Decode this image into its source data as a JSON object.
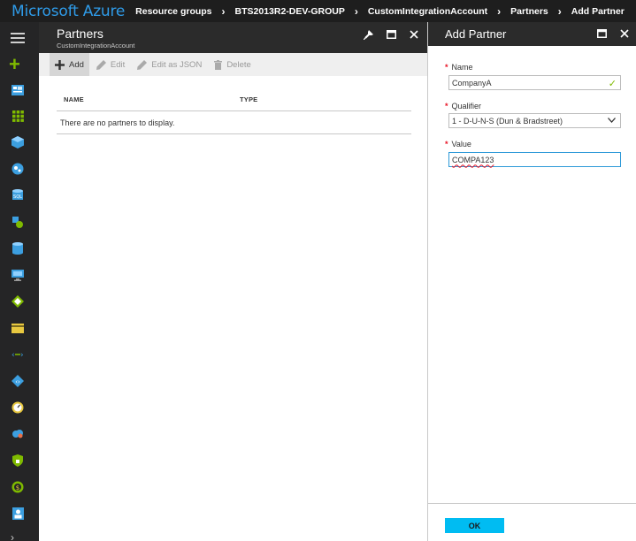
{
  "topbar": {
    "brand": "Microsoft Azure",
    "breadcrumbs": [
      "Resource groups",
      "BTS2013R2-DEV-GROUP",
      "CustomIntegrationAccount",
      "Partners",
      "Add Partner"
    ]
  },
  "rail": {
    "icons": [
      "menu-icon",
      "new-icon",
      "dashboard-icon",
      "all-resources-icon",
      "resource-groups-icon",
      "app-services-icon",
      "sql-databases-icon",
      "cloud-services-icon",
      "storage-icon",
      "virtual-machines-icon",
      "load-balancers-icon",
      "subscriptions-icon",
      "virtual-networks-icon",
      "marketplace-icon",
      "monitor-icon",
      "hdinsight-icon",
      "security-center-icon",
      "cost-icon",
      "users-icon",
      "more-services-icon"
    ]
  },
  "partners_blade": {
    "title": "Partners",
    "subtitle": "CustomIntegrationAccount",
    "commands": {
      "add": "Add",
      "edit": "Edit",
      "edit_json": "Edit as JSON",
      "delete": "Delete"
    },
    "columns": {
      "name": "NAME",
      "type": "TYPE"
    },
    "empty_message": "There are no partners to display."
  },
  "add_partner_blade": {
    "title": "Add Partner",
    "name_label": "Name",
    "name_value": "CompanyA",
    "qualifier_label": "Qualifier",
    "qualifier_value": "1 - D-U-N-S (Dun & Bradstreet)",
    "value_label": "Value",
    "value_value": "COMPA123",
    "ok_label": "OK"
  },
  "colors": {
    "brand": "#2f9be8",
    "topbar_bg": "#1e1e1e",
    "rail_bg": "#252526",
    "ok_button": "#00bcf2",
    "required": "#e81123",
    "valid_check": "#7fba00"
  }
}
